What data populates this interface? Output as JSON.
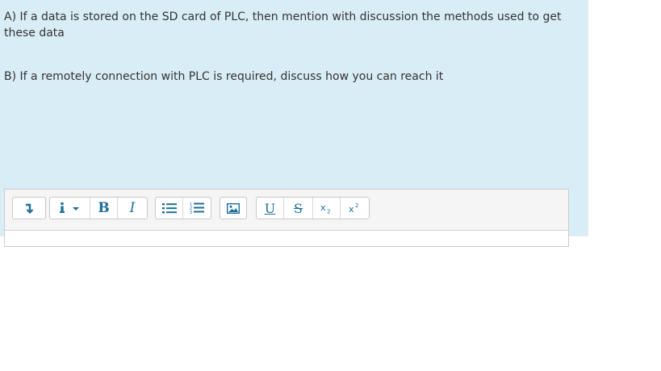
{
  "question": {
    "part_a": "A) If a data is stored on the SD card of PLC, then mention with discussion the methods used to get these data",
    "part_b": "B) If a remotely connection with PLC is required, discuss how you can reach it"
  },
  "toolbar": {
    "icons": [
      "collapse-toolbar-icon",
      "paragraph-style-icon",
      "bold-icon",
      "italic-icon",
      "bulleted-list-icon",
      "numbered-list-icon",
      "insert-image-icon",
      "underline-icon",
      "strikethrough-icon",
      "subscript-icon",
      "superscript-icon"
    ],
    "bold_label": "B",
    "italic_label": "I",
    "underline_label": "U",
    "strike_label": "S",
    "colors": {
      "icon": "#1d6e9a",
      "panel": "#d9edf6",
      "toolbar": "#f5f5f5"
    }
  },
  "editor": {
    "value": ""
  }
}
